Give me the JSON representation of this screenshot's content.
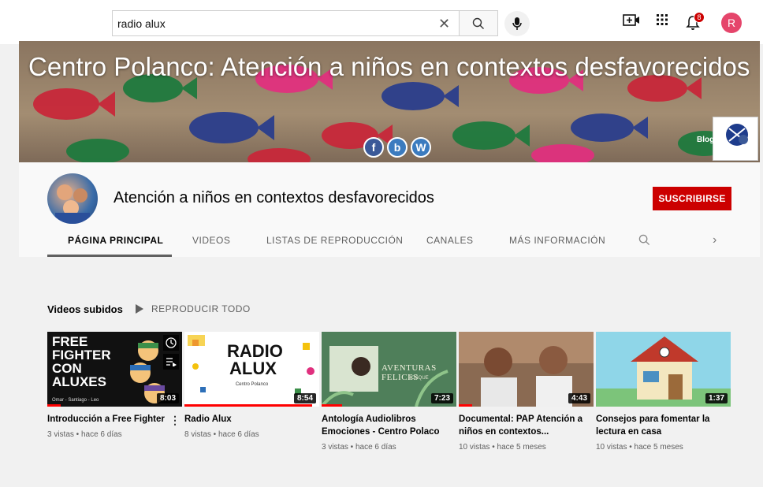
{
  "search": {
    "value": "radio alux",
    "clear_icon": "close-icon",
    "search_icon": "search-icon"
  },
  "topbar": {
    "avatar_letter": "R",
    "notification_count": "8",
    "icons": [
      "mic-icon",
      "create-video-icon",
      "apps-grid-icon",
      "bell-icon"
    ]
  },
  "banner": {
    "title": "Centro Polanco: Atención a niños en contextos desfavorecidos",
    "blog_label": "Blog",
    "social": [
      {
        "label": "f",
        "color": "#3b5998"
      },
      {
        "label": "b",
        "color": "#3b7bbf"
      },
      {
        "label": "W",
        "color": "#3b7bbf"
      }
    ]
  },
  "channel": {
    "name": "Atención a niños en contextos desfavorecidos",
    "subscribe_label": "SUSCRIBIRSE",
    "tabs": [
      {
        "label": "PÁGINA PRINCIPAL",
        "active": true
      },
      {
        "label": "VIDEOS"
      },
      {
        "label": "LISTAS DE REPRODUCCIÓN"
      },
      {
        "label": "CANALES"
      },
      {
        "label": "MÁS INFORMACIÓN"
      }
    ]
  },
  "shelf": {
    "title": "Videos subidos",
    "play_all_label": "REPRODUCIR TODO",
    "videos": [
      {
        "title": "Introducción a Free Fighter",
        "meta": "3 vistas • hace 6 días",
        "duration": "8:03",
        "thumb_text": "FREE FIGHTER CON ALUXES",
        "thumb_caption": "Omar - Santiago - Leo",
        "progress": 0.1
      },
      {
        "title": "Radio Alux",
        "meta": "8 vistas • hace 6 días",
        "duration": "8:54",
        "thumb_text": "RADIO ALUX",
        "thumb_caption": "Centro Polanco",
        "progress": 0.95
      },
      {
        "title": "Antología Audiolibros Emociones - Centro Polaco",
        "meta": "3 vistas • hace 6 días",
        "duration": "7:23",
        "thumb_text": "AVENTURAS FELICES",
        "thumb_caption": "BOSQUE",
        "progress": 0.15
      },
      {
        "title": "Documental: PAP Atención a niños en contextos...",
        "meta": "10 vistas • hace 5 meses",
        "duration": "4:43",
        "progress": 0.1
      },
      {
        "title": "Consejos para fomentar la lectura en casa",
        "meta": "10 vistas • hace 5 meses",
        "duration": "1:37",
        "progress": 0
      }
    ]
  },
  "colors": {
    "brand_red": "#cc0000",
    "progress_red": "#ff0000",
    "avatar_pink": "#e5456b"
  }
}
